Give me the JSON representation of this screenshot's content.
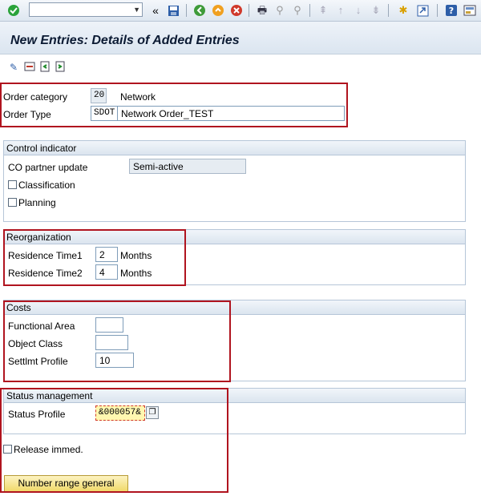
{
  "toolbar": {
    "command_field_value": "",
    "icons": {
      "ok": "check-icon",
      "nav_back": "double-left-icon",
      "save": "save-icon",
      "back": "back-icon",
      "exit": "exit-icon",
      "cancel": "cancel-icon",
      "print": "print-icon",
      "find": "find-icon",
      "find_next": "find-next-icon",
      "first_page": "first-page-icon",
      "prev_page": "prev-page-icon",
      "next_page": "next-page-icon",
      "last_page": "last-page-icon",
      "new_session": "new-session-icon",
      "shortcut": "shortcut-icon",
      "help": "help-icon",
      "layout": "layout-icon"
    }
  },
  "title": "New Entries: Details of Added Entries",
  "header": {
    "order_category_label": "Order category",
    "order_category_value": "20",
    "order_category_text": "Network",
    "order_type_label": "Order Type",
    "order_type_value": "SDOT",
    "order_type_text": "Network Order_TEST"
  },
  "control": {
    "title": "Control indicator",
    "co_partner_label": "CO partner update",
    "co_partner_value": "Semi-active",
    "classification_label": "Classification",
    "planning_label": "Planning"
  },
  "reorg": {
    "title": "Reorganization",
    "res1_label": "Residence Time1",
    "res1_value": "2",
    "res1_unit": "Months",
    "res2_label": "Residence Time2",
    "res2_value": "4",
    "res2_unit": "Months"
  },
  "costs": {
    "title": "Costs",
    "functional_area_label": "Functional Area",
    "functional_area_value": "",
    "object_class_label": "Object Class",
    "object_class_value": "",
    "settlmt_label": "Settlmt Profile",
    "settlmt_value": "10"
  },
  "status": {
    "title": "Status management",
    "profile_label": "Status Profile",
    "profile_value": "&000057&",
    "release_label": "Release immed.",
    "number_range_button": "Number range general"
  },
  "colors": {
    "highlight_border": "#b0141f",
    "group_border": "#b6c6d8",
    "button_fill": "#f0d96a"
  }
}
